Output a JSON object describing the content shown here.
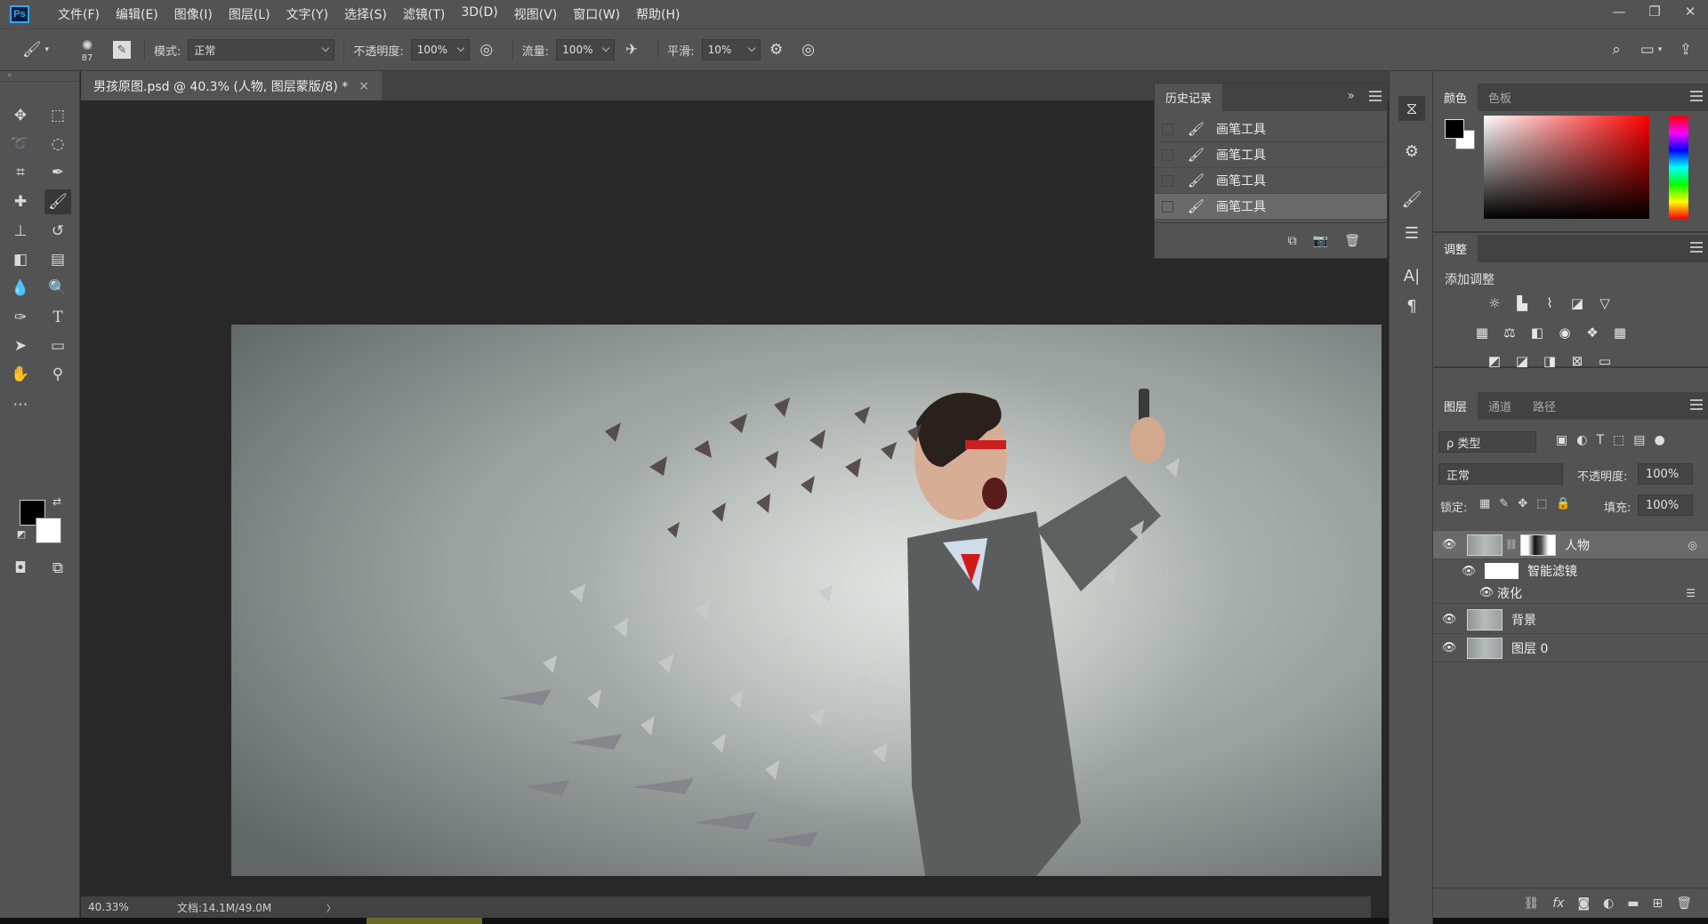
{
  "app": {
    "logo": "Ps"
  },
  "menu": [
    "文件(F)",
    "编辑(E)",
    "图像(I)",
    "图层(L)",
    "文字(Y)",
    "选择(S)",
    "滤镜(T)",
    "3D(D)",
    "视图(V)",
    "窗口(W)",
    "帮助(H)"
  ],
  "window_controls": {
    "minimize": "—",
    "restore": "❐",
    "close": "✕"
  },
  "options": {
    "brush_size": "87",
    "mode_label": "模式:",
    "mode_value": "正常",
    "opacity_label": "不透明度:",
    "opacity_value": "100%",
    "flow_label": "流量:",
    "flow_value": "100%",
    "smoothing_label": "平滑:",
    "smoothing_value": "10%"
  },
  "document": {
    "tab_title": "男孩原图.psd @ 40.3% (人物, 图层蒙版/8) *",
    "tab_close": "×",
    "zoom": "40.33%",
    "doc_info": "文档:14.1M/49.0M",
    "status_arrow": "〉"
  },
  "history": {
    "tab": "历史记录",
    "expand": "»",
    "items": [
      {
        "label": "画笔工具"
      },
      {
        "label": "画笔工具"
      },
      {
        "label": "画笔工具"
      },
      {
        "label": "画笔工具"
      }
    ]
  },
  "color_panel": {
    "tabs": [
      "颜色",
      "色板"
    ]
  },
  "adjustments": {
    "tab": "调整",
    "add_label": "添加调整"
  },
  "layers": {
    "tabs": [
      "图层",
      "通道",
      "路径"
    ],
    "filter_kind": "ρ 类型",
    "blend_mode": "正常",
    "opacity_label": "不透明度:",
    "opacity_value": "100%",
    "lock_label": "锁定:",
    "fill_label": "填充:",
    "fill_value": "100%",
    "items": [
      {
        "name": "人物"
      },
      {
        "name": "智能滤镜"
      },
      {
        "name": "液化"
      },
      {
        "name": "背景"
      },
      {
        "name": "图层 0"
      }
    ]
  },
  "colors": {
    "accent": "#31a8ff",
    "panel": "#535353",
    "workspace": "#282828"
  }
}
